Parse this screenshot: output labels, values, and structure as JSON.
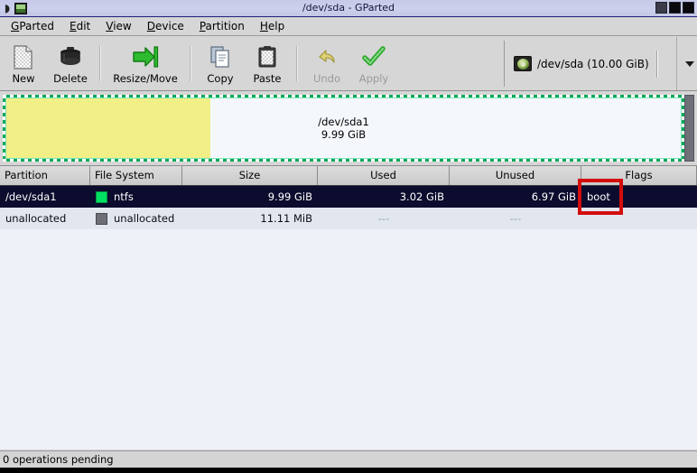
{
  "window": {
    "title": "/dev/sda - GParted",
    "app_icon": "gparted-app-icon",
    "spiral_icon": "menu-spiral-icon",
    "buttons": [
      {
        "name": "minimize-button",
        "label": ""
      },
      {
        "name": "maximize-button",
        "label": ""
      },
      {
        "name": "close-button",
        "label": ""
      }
    ]
  },
  "menubar": {
    "items": [
      {
        "mnemonic": "G",
        "rest": "Parted"
      },
      {
        "mnemonic": "E",
        "rest": "dit"
      },
      {
        "mnemonic": "V",
        "rest": "iew"
      },
      {
        "mnemonic": "D",
        "rest": "evice"
      },
      {
        "mnemonic": "P",
        "rest": "artition"
      },
      {
        "mnemonic": "H",
        "rest": "elp"
      }
    ]
  },
  "toolbar": {
    "buttons": [
      {
        "label": "New",
        "icon": "new-document-icon",
        "enabled": true
      },
      {
        "label": "Delete",
        "icon": "trash-can-icon",
        "enabled": true
      },
      {
        "label": "Resize/Move",
        "icon": "resize-arrow-icon",
        "enabled": true
      },
      {
        "label": "Copy",
        "icon": "copy-pages-icon",
        "enabled": true
      },
      {
        "label": "Paste",
        "icon": "paste-clipboard-icon",
        "enabled": true
      },
      {
        "label": "Undo",
        "icon": "undo-arrow-icon",
        "enabled": false
      },
      {
        "label": "Apply",
        "icon": "apply-check-icon",
        "enabled": false
      }
    ],
    "device_selector": {
      "icon": "hard-disk-icon",
      "text": "/dev/sda  (10.00 GiB)",
      "caret": "chevron-down-icon"
    },
    "overflow_caret": "toolbar-overflow-chevron-icon"
  },
  "graphic": {
    "partition": {
      "name": "/dev/sda1",
      "size": "9.99 GiB",
      "used_fraction": 0.302,
      "used_color": "#f1ef86",
      "unused_color": "#f4f8fc",
      "border_color": "#0aa85a"
    },
    "unallocated_block": {
      "name": "unallocated",
      "color": "#6f6f78"
    }
  },
  "table": {
    "columns": [
      {
        "label": "Partition",
        "align": "left"
      },
      {
        "label": "File System",
        "align": "left"
      },
      {
        "label": "Size",
        "align": "center"
      },
      {
        "label": "Used",
        "align": "center"
      },
      {
        "label": "Unused",
        "align": "center"
      },
      {
        "label": "Flags",
        "align": "center"
      }
    ],
    "rows": [
      {
        "partition": "/dev/sda1",
        "filesystem": "ntfs",
        "swatch_color": "#00e062",
        "size": "9.99 GiB",
        "used": "3.02 GiB",
        "unused": "6.97 GiB",
        "flags": "boot",
        "selected": true
      },
      {
        "partition": "unallocated",
        "filesystem": "unallocated",
        "swatch_color": "#6f6f78",
        "size": "11.11 MiB",
        "used": "---",
        "unused": "---",
        "flags": "",
        "selected": false
      }
    ]
  },
  "annotation": {
    "name": "boot-flag-highlight",
    "color": "#d40d0d"
  },
  "statusbar": {
    "text": "0 operations pending"
  }
}
